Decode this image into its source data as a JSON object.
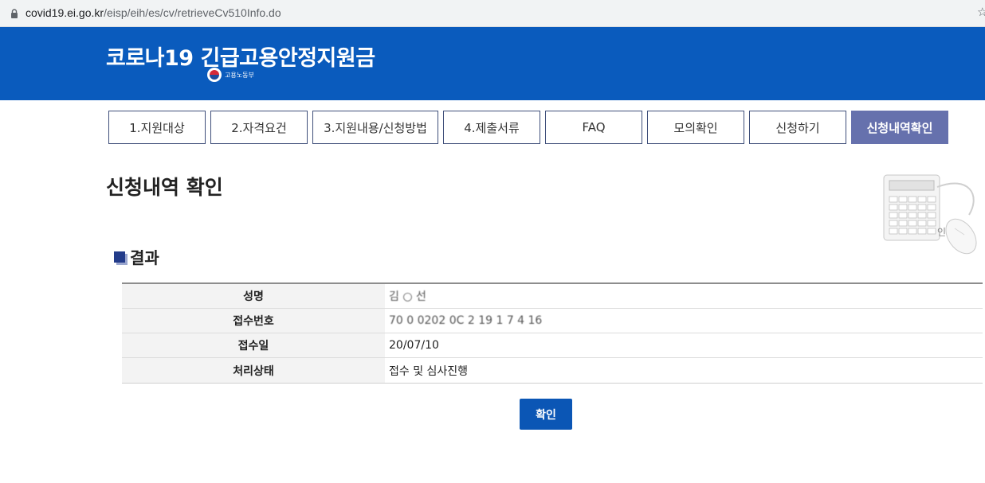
{
  "browser": {
    "url_host": "covid19.ei.go.kr",
    "url_path": "/eisp/eih/es/cv/retrieveCv510Info.do",
    "star_icon": "star-icon",
    "lock_icon": "lock-icon"
  },
  "banner": {
    "title": "코로나19 긴급고용안정지원금",
    "ministry": "고용노동부",
    "background": "#0a5bbd"
  },
  "nav": {
    "tabs": [
      {
        "label": "1.지원대상",
        "active": false
      },
      {
        "label": "2.자격요건",
        "active": false
      },
      {
        "label": "3.지원내용/신청방법",
        "active": false
      },
      {
        "label": "4.제출서류",
        "active": false
      },
      {
        "label": "FAQ",
        "active": false
      },
      {
        "label": "모의확인",
        "active": false
      },
      {
        "label": "신청하기",
        "active": false
      },
      {
        "label": "신청내역확인",
        "active": true
      }
    ],
    "active_color": "#6671ad"
  },
  "page": {
    "title": "신청내역 확인",
    "deco_text": "인",
    "section_title": "결과"
  },
  "result": {
    "rows": [
      {
        "label": "성명",
        "value": "김 ○ 선"
      },
      {
        "label": "접수번호",
        "value": "70 0 0202 0C 2 19 1 7 4 16"
      },
      {
        "label": "접수일",
        "value": "20/07/10"
      },
      {
        "label": "처리상태",
        "value": "접수 및 심사진행"
      }
    ]
  },
  "actions": {
    "confirm_label": "확인",
    "confirm_color": "#0b56b5"
  }
}
